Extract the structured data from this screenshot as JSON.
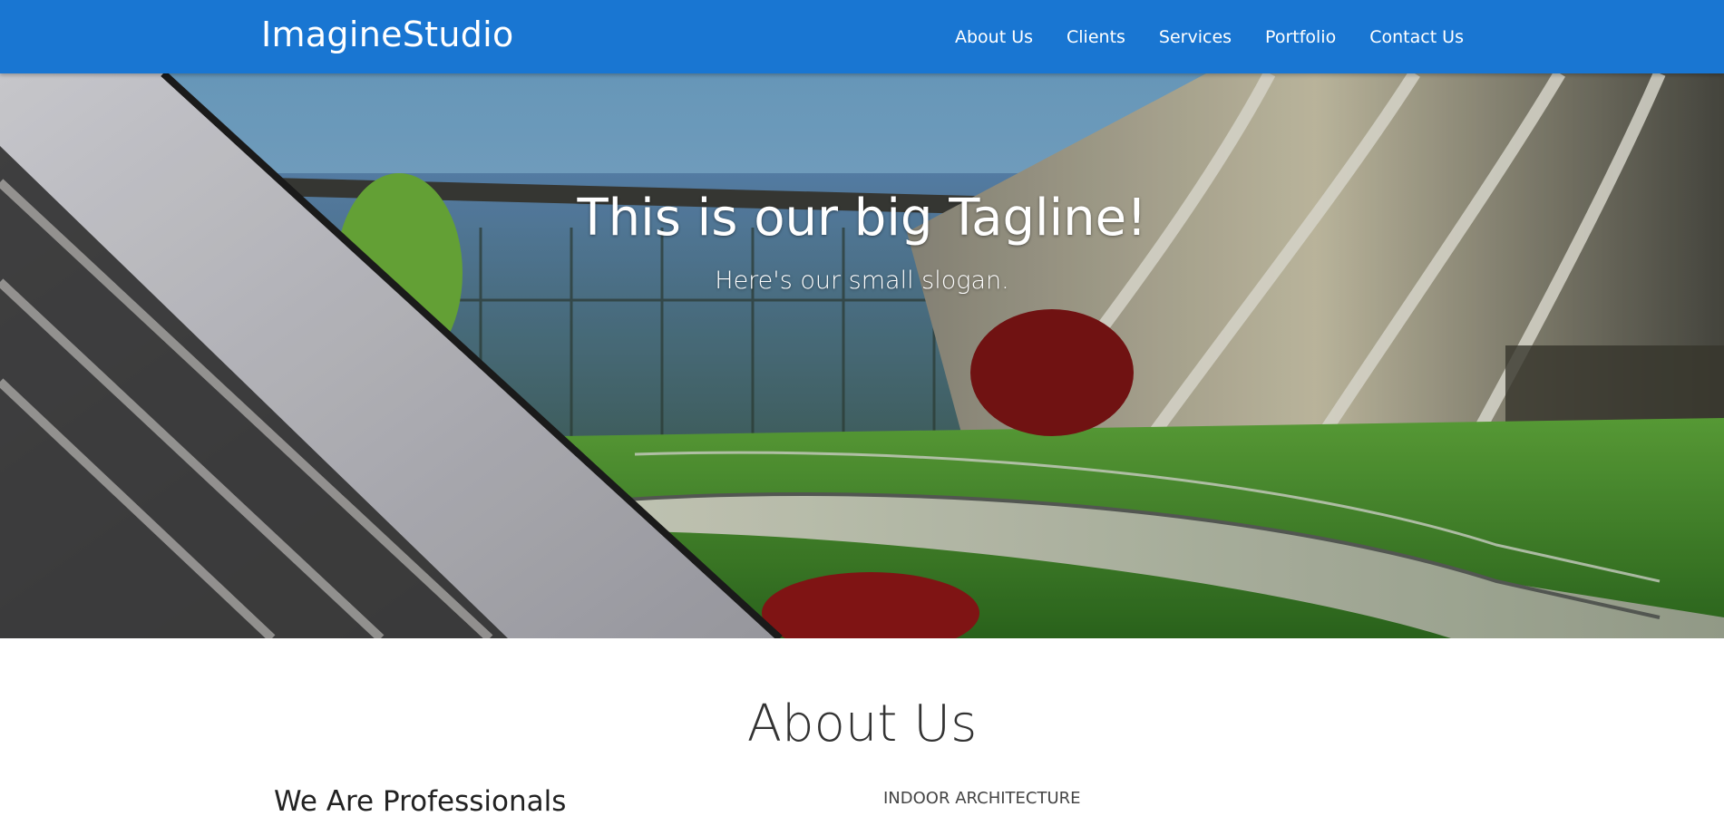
{
  "header": {
    "brand": "ImagineStudio",
    "nav": [
      "About Us",
      "Clients",
      "Services",
      "Portfolio",
      "Contact Us"
    ],
    "background_color": "#1976d2"
  },
  "hero": {
    "tagline": "This is our big Tagline!",
    "slogan": "Here's our small slogan."
  },
  "about": {
    "title": "About Us",
    "left_heading": "We Are Professionals",
    "right_label": "INDOOR ARCHITECTURE"
  }
}
